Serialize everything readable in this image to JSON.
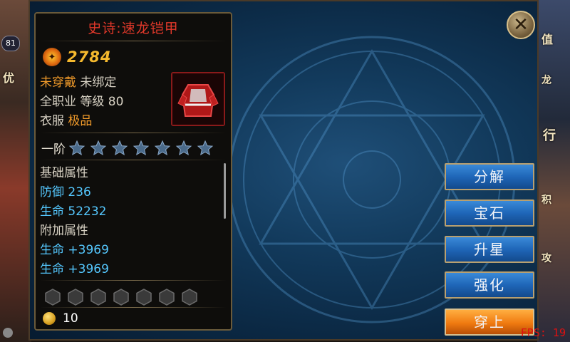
{
  "side_left": {
    "level": "81",
    "label1": "优"
  },
  "side_right": {
    "label1": "值",
    "label2": "龙",
    "label3": "行",
    "label4": "积",
    "label5": "攻"
  },
  "item": {
    "title": "史诗:速龙铠甲",
    "power": "2784",
    "status_equipped": "未穿戴",
    "status_bound": "未绑定",
    "job": "全职业",
    "level_text": "等级 80",
    "slot": "衣服",
    "quality": "极品",
    "star_tier": "一阶",
    "stars_total": 7,
    "stars_filled": 0,
    "attributes": [
      {
        "text": "基础属性",
        "kind": "head"
      },
      {
        "text": "防御 236",
        "kind": "val"
      },
      {
        "text": "生命 52232",
        "kind": "val"
      },
      {
        "text": "附加属性",
        "kind": "head"
      },
      {
        "text": "生命 +3969",
        "kind": "val"
      },
      {
        "text": "生命 +3969",
        "kind": "val"
      }
    ],
    "gem_slots": 7,
    "coin_value": "10"
  },
  "actions": {
    "decompose": "分解",
    "gem": "宝石",
    "star_up": "升星",
    "enhance": "强化",
    "equip": "穿上"
  },
  "close_icon": "close-icon",
  "fps": "FPS: 19",
  "colors": {
    "title_red": "#e0382a",
    "power_gold": "#f5b92e",
    "attr_blue": "#55c8ff",
    "button_blue": "#1f66b8",
    "button_orange": "#f07a10"
  }
}
